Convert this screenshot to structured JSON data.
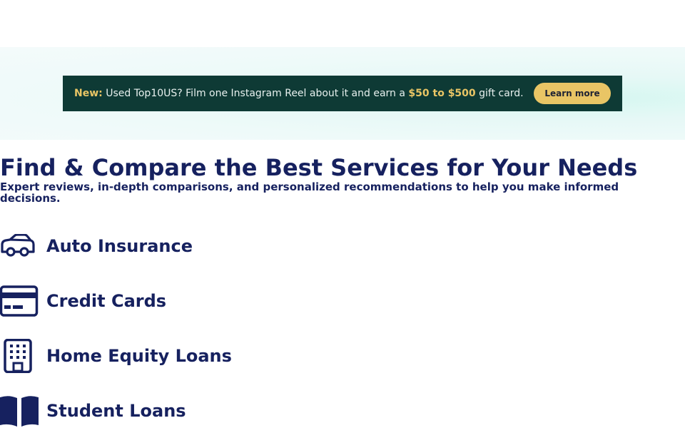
{
  "promo": {
    "prefix": "New:",
    "text_1": " Used Top10US? Film one Instagram Reel about it and earn a ",
    "amount": "$50 to $500",
    "text_2": " gift card.",
    "button_label": "Learn more"
  },
  "hero": {
    "title": "Find & Compare the Best Services for Your Needs",
    "subtitle": "Expert reviews, in-depth comparisons, and personalized recommendations to help you make informed decisions."
  },
  "categories": [
    {
      "label": "Auto Insurance",
      "icon": "car-icon"
    },
    {
      "label": "Credit Cards",
      "icon": "credit-card-icon"
    },
    {
      "label": "Home Equity Loans",
      "icon": "building-icon"
    },
    {
      "label": "Student Loans",
      "icon": "book-icon"
    }
  ],
  "colors": {
    "navy": "#16215f",
    "promo_bg": "#0e3a35",
    "gold": "#e9c565",
    "band_bg": "#e6f8f6"
  }
}
